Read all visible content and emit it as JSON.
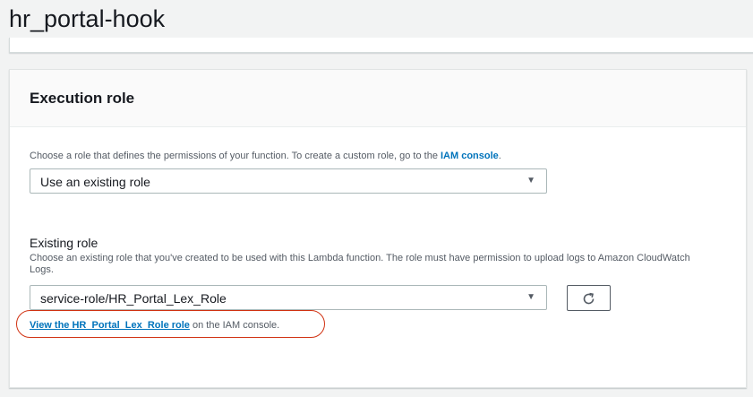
{
  "page": {
    "title": "hr_portal-hook"
  },
  "execution_role": {
    "title": "Execution role",
    "description_prefix": "Choose a role that defines the permissions of your function. To create a custom role, go to the ",
    "description_link": "IAM console",
    "description_suffix": ".",
    "role_select": {
      "selected": "Use an existing role",
      "caret_icon": "caret-down-icon"
    },
    "existing_role": {
      "label": "Existing role",
      "description": "Choose an existing role that you've created to be used with this Lambda function. The role must have permission to upload logs to Amazon CloudWatch Logs.",
      "selected": "service-role/HR_Portal_Lex_Role",
      "refresh_icon": "refresh-icon"
    },
    "view_role": {
      "link_text": "View the HR_Portal_Lex_Role role",
      "suffix": " on the IAM console."
    }
  },
  "colors": {
    "link": "#0073bb",
    "annotation": "#d13212",
    "page_background": "#f2f3f3"
  }
}
